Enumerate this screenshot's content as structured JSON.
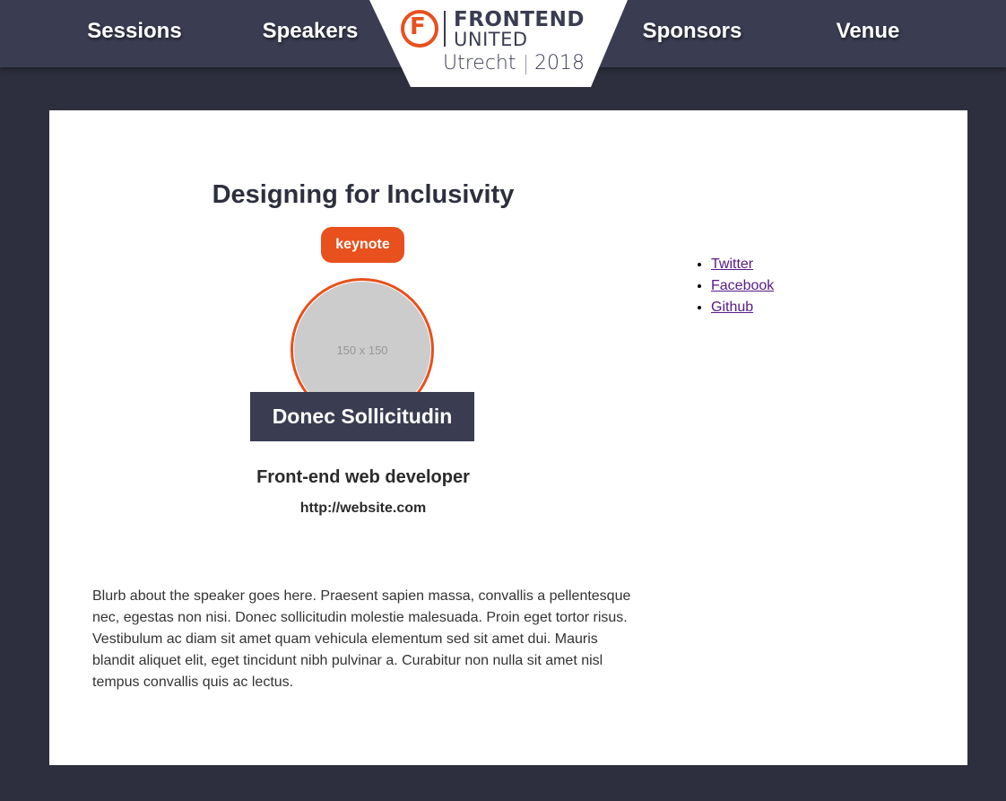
{
  "nav": {
    "left": [
      {
        "label": "Sessions"
      },
      {
        "label": "Speakers"
      }
    ],
    "right": [
      {
        "label": "Sponsors"
      },
      {
        "label": "Venue"
      }
    ]
  },
  "logo": {
    "letter": "F",
    "line1": "FRONTEND",
    "line2": "UNITED",
    "city": "Utrecht",
    "year": "2018"
  },
  "colors": {
    "accent": "#e8501d",
    "navy": "#3a3d52",
    "page_bg": "#2d2f3e"
  },
  "talk": {
    "title": "Designing for Inclusivity",
    "badge": "keynote"
  },
  "speaker": {
    "avatar_placeholder": "150 x 150",
    "name": "Donec Sollicitudin",
    "role": "Front-end web developer",
    "website": "http://website.com",
    "bio": "Blurb about the speaker goes here. Praesent sapien massa, convallis a pellentesque nec, egestas non nisi. Donec sollicitudin molestie malesuada. Proin eget tortor risus. Vestibulum ac diam sit amet quam vehicula elementum sed sit amet dui. Mauris blandit aliquet elit, eget tincidunt nibh pulvinar a. Curabitur non nulla sit amet nisl tempus convallis quis ac lectus."
  },
  "social": [
    {
      "label": "Twitter"
    },
    {
      "label": "Facebook"
    },
    {
      "label": "Github"
    }
  ]
}
